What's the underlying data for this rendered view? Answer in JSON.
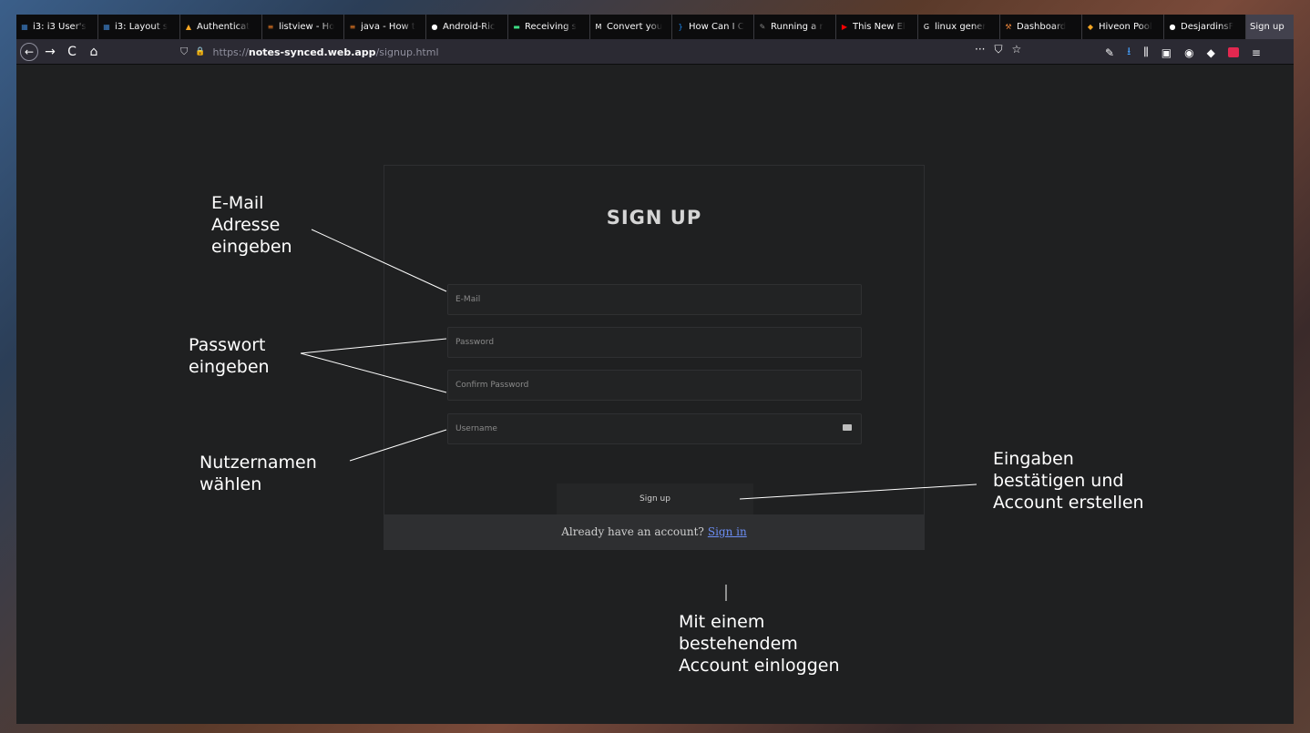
{
  "tabs": [
    {
      "label": "i3: i3 User's",
      "fav_color": "#3c7dc4",
      "fav_glyph": "▦"
    },
    {
      "label": "i3: Layout s",
      "fav_color": "#3c7dc4",
      "fav_glyph": "▦"
    },
    {
      "label": "Authenticat",
      "fav_color": "#f5a623",
      "fav_glyph": "▲"
    },
    {
      "label": "listview - Ho",
      "fav_color": "#f48024",
      "fav_glyph": "≡"
    },
    {
      "label": "java - How t",
      "fav_color": "#f48024",
      "fav_glyph": "≡"
    },
    {
      "label": "Android-Ric",
      "fav_color": "#ffffff",
      "fav_glyph": "●"
    },
    {
      "label": "Receiving s",
      "fav_color": "#3ddc84",
      "fav_glyph": "▬"
    },
    {
      "label": "Convert you",
      "fav_color": "#ffffff",
      "fav_glyph": "M"
    },
    {
      "label": "How Can I C",
      "fav_color": "#1e90ff",
      "fav_glyph": "}"
    },
    {
      "label": "Running a r",
      "fav_color": "#888888",
      "fav_glyph": "✎"
    },
    {
      "label": "This New El",
      "fav_color": "#ff0000",
      "fav_glyph": "▶"
    },
    {
      "label": "linux gener",
      "fav_color": "#ffffff",
      "fav_glyph": "G"
    },
    {
      "label": "Dashboard",
      "fav_color": "#e8833a",
      "fav_glyph": "⚒"
    },
    {
      "label": "Hiveon Pool",
      "fav_color": "#f5a623",
      "fav_glyph": "◆"
    },
    {
      "label": "DesjardinsF",
      "fav_color": "#ffffff",
      "fav_glyph": "●"
    }
  ],
  "active_tab": {
    "label": "Sign up",
    "close": "×"
  },
  "new_tab": "+",
  "nav": {
    "back": "←",
    "forward": "→",
    "reload": "C",
    "home": "⌂"
  },
  "url": {
    "proto": "https://",
    "host": "notes-synced.web.app",
    "path": "/signup.html"
  },
  "url_icons": {
    "shield": "⛉",
    "lock": "🔒"
  },
  "url_actions": {
    "more": "···",
    "pocket": "⛉",
    "bookmark": "☆"
  },
  "form": {
    "title": "SIGN UP",
    "email_placeholder": "E-Mail",
    "password_placeholder": "Password",
    "confirm_placeholder": "Confirm Password",
    "username_placeholder": "Username",
    "submit_label": "Sign up",
    "footer_text": "Already have an account?",
    "signin_link": "Sign in"
  },
  "annotations": {
    "email": "E-Mail\nAdresse\neingeben",
    "password": "Passwort\neingeben",
    "username": "Nutzernamen\nwählen",
    "submit": "Eingaben\nbestätigen und\nAccount erstellen",
    "signin": "Mit einem\nbestehendem\nAccount einloggen"
  }
}
